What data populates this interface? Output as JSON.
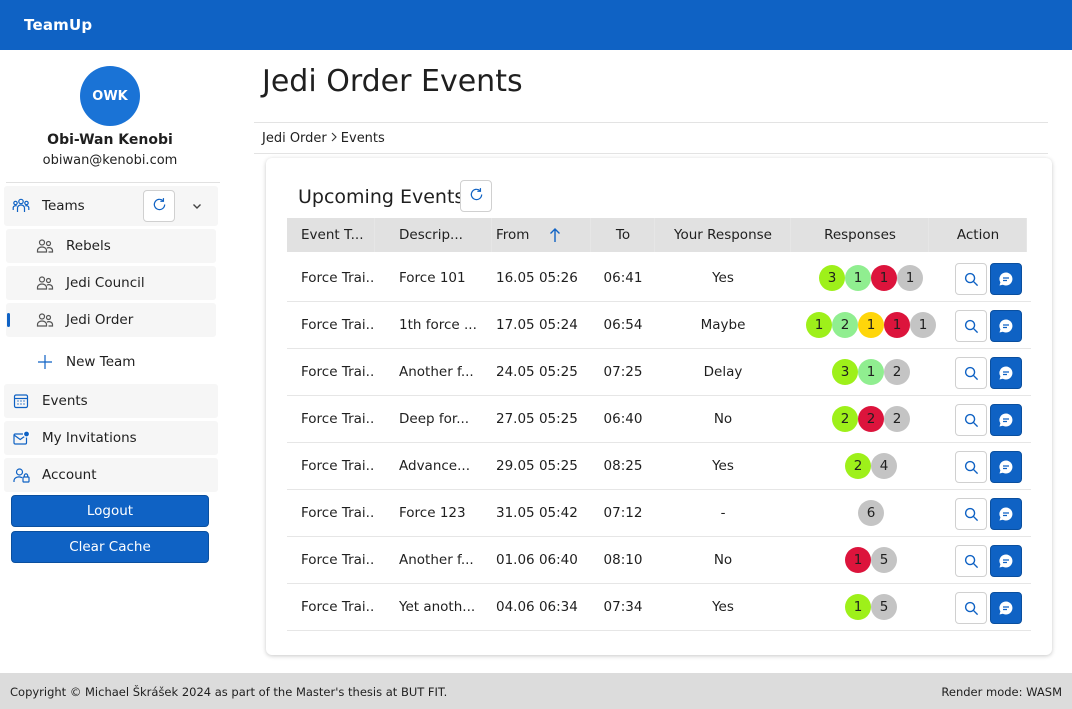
{
  "app": {
    "name": "TeamUp"
  },
  "user": {
    "initials": "OWK",
    "name": "Obi-Wan Kenobi",
    "email": "obiwan@kenobi.com"
  },
  "sidebar": {
    "teams_label": "Teams",
    "teams": [
      {
        "label": "Rebels",
        "active": false
      },
      {
        "label": "Jedi Council",
        "active": false
      },
      {
        "label": "Jedi Order",
        "active": true
      }
    ],
    "new_team_label": "New Team",
    "events_label": "Events",
    "invitations_label": "My Invitations",
    "account_label": "Account",
    "logout_label": "Logout",
    "clear_cache_label": "Clear Cache"
  },
  "page": {
    "title": "Jedi Order Events",
    "breadcrumb": [
      "Jedi Order",
      "Events"
    ]
  },
  "events": {
    "title": "Upcoming Events",
    "columns": {
      "type": "Event T...",
      "description": "Descrip...",
      "from": "From",
      "to": "To",
      "response": "Your Response",
      "responses": "Responses",
      "action": "Action"
    },
    "sort": {
      "column": "from",
      "direction": "ascending"
    },
    "rows": [
      {
        "type": "Force Trai...",
        "description": "Force 101",
        "from": "16.05 05:26",
        "to": "06:41",
        "response": "Yes",
        "counts": [
          {
            "value": "3",
            "status": "yes"
          },
          {
            "value": "1",
            "status": "maybe"
          },
          {
            "value": "1",
            "status": "no"
          },
          {
            "value": "1",
            "status": "none"
          }
        ]
      },
      {
        "type": "Force Trai...",
        "description": "1th force ...",
        "from": "17.05 05:24",
        "to": "06:54",
        "response": "Maybe",
        "counts": [
          {
            "value": "1",
            "status": "yes"
          },
          {
            "value": "2",
            "status": "maybe"
          },
          {
            "value": "1",
            "status": "delay"
          },
          {
            "value": "1",
            "status": "no"
          },
          {
            "value": "1",
            "status": "none"
          }
        ]
      },
      {
        "type": "Force Trai...",
        "description": "Another f...",
        "from": "24.05 05:25",
        "to": "07:25",
        "response": "Delay",
        "counts": [
          {
            "value": "3",
            "status": "yes"
          },
          {
            "value": "1",
            "status": "maybe"
          },
          {
            "value": "2",
            "status": "none"
          }
        ]
      },
      {
        "type": "Force Trai...",
        "description": "Deep for...",
        "from": "27.05 05:25",
        "to": "06:40",
        "response": "No",
        "counts": [
          {
            "value": "2",
            "status": "yes"
          },
          {
            "value": "2",
            "status": "no"
          },
          {
            "value": "2",
            "status": "none"
          }
        ]
      },
      {
        "type": "Force Trai...",
        "description": "Advance...",
        "from": "29.05 05:25",
        "to": "08:25",
        "response": "Yes",
        "counts": [
          {
            "value": "2",
            "status": "yes"
          },
          {
            "value": "4",
            "status": "none"
          }
        ]
      },
      {
        "type": "Force Trai...",
        "description": "Force 123",
        "from": "31.05 05:42",
        "to": "07:12",
        "response": "-",
        "counts": [
          {
            "value": "6",
            "status": "none"
          }
        ]
      },
      {
        "type": "Force Trai...",
        "description": "Another f...",
        "from": "01.06 06:40",
        "to": "08:10",
        "response": "No",
        "counts": [
          {
            "value": "1",
            "status": "no"
          },
          {
            "value": "5",
            "status": "none"
          }
        ]
      },
      {
        "type": "Force Trai...",
        "description": "Yet anoth...",
        "from": "04.06 06:34",
        "to": "07:34",
        "response": "Yes",
        "counts": [
          {
            "value": "1",
            "status": "yes"
          },
          {
            "value": "5",
            "status": "none"
          }
        ]
      }
    ]
  },
  "status_colors": {
    "yes": "#9ef01a",
    "maybe": "#90ee90",
    "delay": "#ffd60a",
    "no": "#dc143c",
    "none": "#c4c4c4"
  },
  "footer": {
    "copyright": "Copyright © Michael Škrášek 2024 as part of the Master's thesis at BUT FIT.",
    "render_mode": "Render mode: WASM"
  }
}
